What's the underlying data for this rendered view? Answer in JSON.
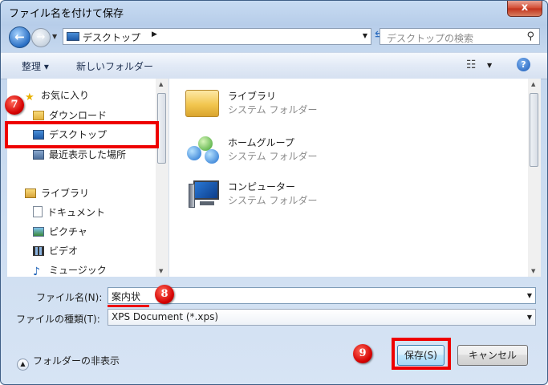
{
  "window": {
    "title": "ファイル名を付けて保存",
    "close_glyph": "x"
  },
  "nav": {
    "address": "デスクトップ",
    "search_placeholder": "デスクトップの検索"
  },
  "toolbar": {
    "organize": "整理 ▾",
    "new_folder": "新しいフォルダー"
  },
  "sidebar": {
    "items": [
      {
        "label": "お気に入り",
        "icon": "star-icon"
      },
      {
        "label": "ダウンロード",
        "icon": "download-folder-icon"
      },
      {
        "label": "デスクトップ",
        "icon": "desktop-icon"
      },
      {
        "label": "最近表示した場所",
        "icon": "recent-places-icon"
      },
      {
        "label": "ライブラリ",
        "icon": "library-icon"
      },
      {
        "label": "ドキュメント",
        "icon": "document-icon"
      },
      {
        "label": "ピクチャ",
        "icon": "picture-icon"
      },
      {
        "label": "ビデオ",
        "icon": "video-icon"
      },
      {
        "label": "ミュージック",
        "icon": "music-icon"
      }
    ]
  },
  "content": {
    "items": [
      {
        "name": "ライブラリ",
        "type": "システム フォルダー",
        "icon": "library-folder-icon"
      },
      {
        "name": "ホームグループ",
        "type": "システム フォルダー",
        "icon": "homegroup-icon"
      },
      {
        "name": "コンピューター",
        "type": "システム フォルダー",
        "icon": "computer-icon"
      }
    ]
  },
  "form": {
    "filename_label": "ファイル名(N):",
    "filename_value": "案内状",
    "filetype_label": "ファイルの種類(T):",
    "filetype_value": "XPS Document (*.xps)"
  },
  "footer": {
    "hide_folders": "フォルダーの非表示",
    "save": "保存(S)",
    "cancel": "キャンセル"
  },
  "annotations": {
    "marker7": "7",
    "marker8": "8",
    "marker9": "9"
  },
  "colors": {
    "highlight": "#e00000",
    "accent": "#1b5bb8"
  }
}
